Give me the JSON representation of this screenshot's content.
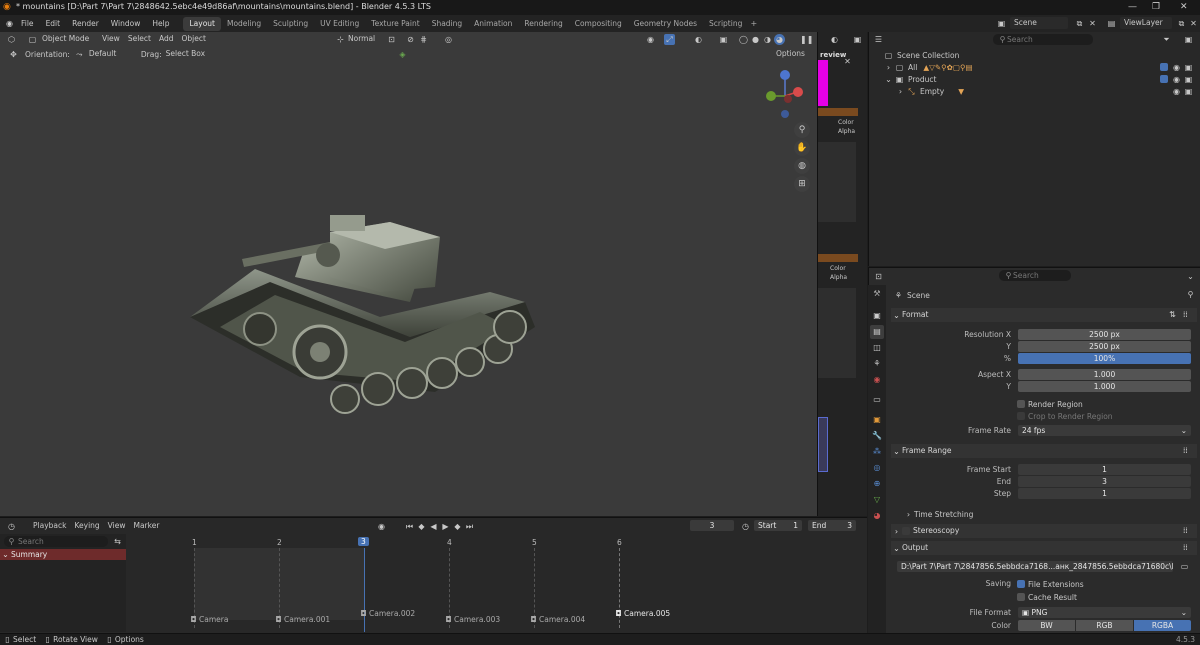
{
  "window": {
    "title": "* mountains [D:\\Part 7\\Part 7\\2848642.5ebc4e49d86af\\mountains\\mountains.blend] - Blender 4.5.3 LTS"
  },
  "menu": [
    "File",
    "Edit",
    "Render",
    "Window",
    "Help"
  ],
  "workspaces": [
    "Layout",
    "Modeling",
    "Sculpting",
    "UV Editing",
    "Texture Paint",
    "Shading",
    "Animation",
    "Rendering",
    "Compositing",
    "Geometry Nodes",
    "Scripting"
  ],
  "active_workspace": "Layout",
  "scene_selector": {
    "scene": "Scene",
    "view_layer": "ViewLayer"
  },
  "viewport": {
    "mode": "Object Mode",
    "menus": [
      "View",
      "Select",
      "Add",
      "Object"
    ],
    "shading_normal": "Normal",
    "orientation_label": "Orientation:",
    "orientation_value": "Default",
    "drag_label": "Drag:",
    "drag_value": "Select Box",
    "options": "Options"
  },
  "node_panel": {
    "label_preview": "review",
    "color": "Color",
    "alpha": "Alpha"
  },
  "outliner": {
    "search_placeholder": "Search",
    "root": "Scene Collection",
    "items": [
      "All",
      "Product",
      "Empty"
    ]
  },
  "properties": {
    "search_placeholder": "Search",
    "context": "Scene",
    "format": {
      "title": "Format",
      "resolution_x_label": "Resolution X",
      "resolution_x": "2500 px",
      "y_label": "Y",
      "resolution_y": "2500 px",
      "percent_label": "%",
      "percent": "100%",
      "aspect_x_label": "Aspect X",
      "aspect_x": "1.000",
      "aspect_y_label": "Y",
      "aspect_y": "1.000",
      "render_region": "Render Region",
      "crop_region": "Crop to Render Region",
      "frame_rate_label": "Frame Rate",
      "frame_rate": "24 fps"
    },
    "frame_range": {
      "title": "Frame Range",
      "start_label": "Frame Start",
      "start": "1",
      "end_label": "End",
      "end": "3",
      "step_label": "Step",
      "step": "1",
      "time_stretching": "Time Stretching"
    },
    "stereoscopy": "Stereoscopy",
    "output": {
      "title": "Output",
      "path": "D:\\Part 7\\Part 7\\2847856.5ebbdca7168...анк_2847856.5ebbdca71680c\\Renders",
      "saving_label": "Saving",
      "file_extensions": "File Extensions",
      "cache_result": "Cache Result",
      "file_format_label": "File Format",
      "file_format": "PNG",
      "color_label": "Color",
      "color_options": [
        "BW",
        "RGB",
        "RGBA"
      ],
      "color_selected": "RGBA"
    }
  },
  "timeline": {
    "menus": [
      "Playback",
      "Keying",
      "View",
      "Marker"
    ],
    "current_frame": "3",
    "start_label": "Start",
    "start": "1",
    "end_label": "End",
    "end": "3",
    "search_placeholder": "Search",
    "summary": "Summary",
    "frames": [
      "1",
      "2",
      "3",
      "4",
      "5",
      "6"
    ],
    "markers": [
      "Camera",
      "Camera.001",
      "Camera.002",
      "Camera.003",
      "Camera.004",
      "Camera.005"
    ]
  },
  "status": {
    "items": [
      "Select",
      "Rotate View",
      "Options"
    ],
    "version": "4.5.3"
  },
  "colors": {
    "accent": "#4772b3",
    "timeline_cursor": "#4772b3",
    "summary_bar": "#6e2b2b"
  }
}
